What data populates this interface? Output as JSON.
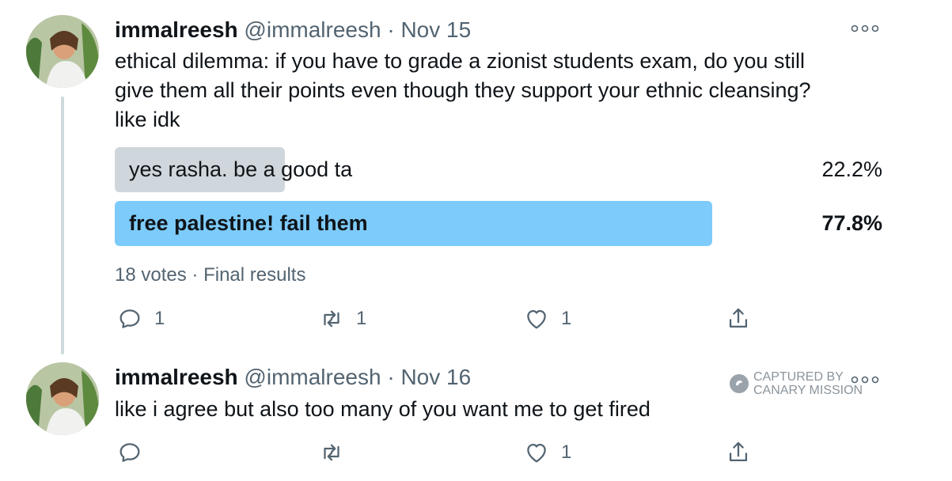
{
  "tweets": [
    {
      "display_name": "immalreesh",
      "handle": "@immalreesh",
      "sep": "·",
      "date": "Nov 15",
      "text_lines": [
        "ethical dilemma: if you have to grade a zionist students exam, do you still",
        "give them all their points even though they support your ethnic cleansing?",
        "like idk"
      ],
      "poll": {
        "options": [
          {
            "label": "yes rasha. be a good ta",
            "percent": "22.2%",
            "fraction": 0.222,
            "winner": false
          },
          {
            "label": "free palestine! fail them",
            "percent": "77.8%",
            "fraction": 0.778,
            "winner": true
          }
        ],
        "votes": "18 votes",
        "sep": "·",
        "status": "Final results"
      },
      "actions": {
        "reply": "1",
        "retweet": "1",
        "like": "1"
      }
    },
    {
      "display_name": "immalreesh",
      "handle": "@immalreesh",
      "sep": "·",
      "date": "Nov 16",
      "text_lines": [
        "like i agree but also too many of you want me to get fired"
      ],
      "actions": {
        "reply": "",
        "retweet": "",
        "like": "1"
      }
    }
  ],
  "watermark": {
    "line1": "CAPTURED BY",
    "line2": "CANARY MISSION"
  },
  "colors": {
    "poll_winner": "#7dcbfa",
    "poll_other": "#cfd7dc",
    "muted": "#536471",
    "thread_line": "#cfd9de"
  },
  "icons": [
    "more-icon",
    "reply-icon",
    "retweet-icon",
    "like-icon",
    "share-icon",
    "canary-icon"
  ]
}
